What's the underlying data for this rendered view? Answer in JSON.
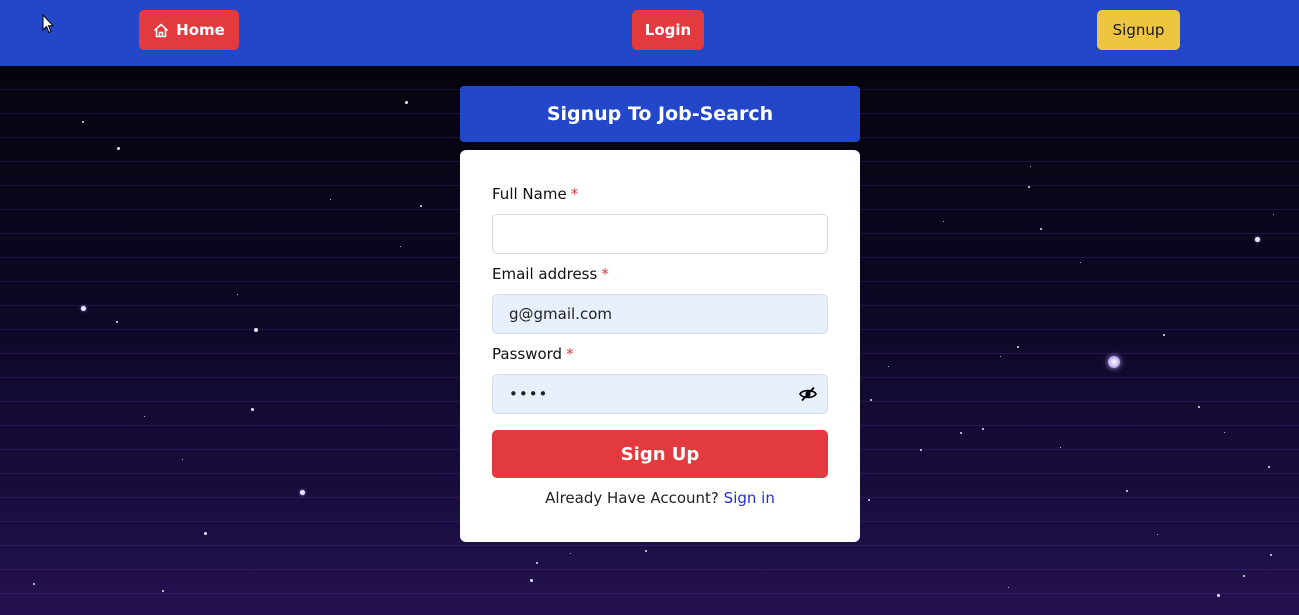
{
  "nav": {
    "home_label": "Home",
    "login_label": "Login",
    "signup_label": "Signup",
    "home_icon": "home-icon"
  },
  "form": {
    "title": "Signup To Job-Search",
    "fields": {
      "full_name": {
        "label": "Full Name",
        "required_mark": "*",
        "value": ""
      },
      "email": {
        "label": "Email address",
        "required_mark": "*",
        "value": "g@gmail.com"
      },
      "password": {
        "label": "Password",
        "required_mark": "*",
        "value": "••••",
        "toggle_icon": "eye-slash-icon"
      }
    },
    "submit_label": "Sign Up",
    "footer_text": "Already Have Account?",
    "footer_link": "Sign in"
  },
  "colors": {
    "navbar": "#2247c8",
    "primary_red": "#e23a3e",
    "signup_yellow": "#eec540",
    "link_blue": "#2231d8"
  }
}
